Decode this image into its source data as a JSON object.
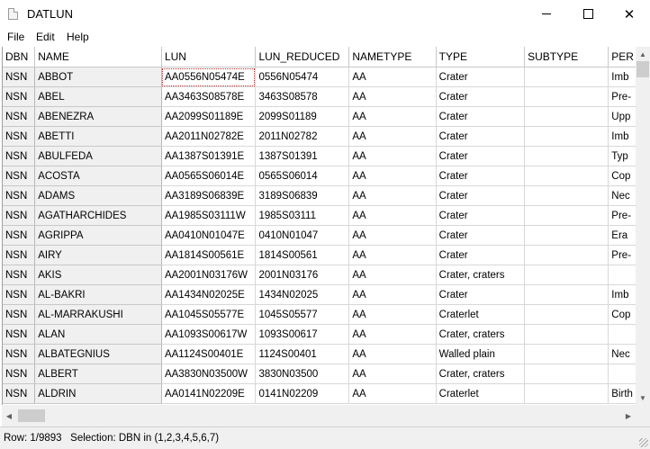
{
  "window": {
    "title": "DATLUN",
    "min_icon": "minimize-icon",
    "max_icon": "maximize-icon",
    "close_icon": "close-icon"
  },
  "menu": [
    "File",
    "Edit",
    "Help"
  ],
  "columns": [
    {
      "label": "DBN",
      "w": 31
    },
    {
      "label": "NAME",
      "w": 150
    },
    {
      "label": "LUN",
      "w": 100
    },
    {
      "label": "LUN_REDUCED",
      "w": 100
    },
    {
      "label": "NAMETYPE",
      "w": 100
    },
    {
      "label": "TYPE",
      "w": 100
    },
    {
      "label": "SUBTYPE",
      "w": 100
    },
    {
      "label": "PER",
      "w": 23
    }
  ],
  "rows": [
    [
      "NSN",
      "ABBOT",
      "AA0556N05474E",
      "0556N05474",
      "AA",
      "Crater",
      "",
      "Imb"
    ],
    [
      "NSN",
      "ABEL",
      "AA3463S08578E",
      "3463S08578",
      "AA",
      "Crater",
      "",
      "Pre-"
    ],
    [
      "NSN",
      "ABENEZRA",
      "AA2099S01189E",
      "2099S01189",
      "AA",
      "Crater",
      "",
      "Upp"
    ],
    [
      "NSN",
      "ABETTI",
      "AA2011N02782E",
      "2011N02782",
      "AA",
      "Crater",
      "",
      "Imb"
    ],
    [
      "NSN",
      "ABULFEDA",
      "AA1387S01391E",
      "1387S01391",
      "AA",
      "Crater",
      "",
      "Typ"
    ],
    [
      "NSN",
      "ACOSTA",
      "AA0565S06014E",
      "0565S06014",
      "AA",
      "Crater",
      "",
      "Cop"
    ],
    [
      "NSN",
      "ADAMS",
      "AA3189S06839E",
      "3189S06839",
      "AA",
      "Crater",
      "",
      "Nec"
    ],
    [
      "NSN",
      "AGATHARCHIDES",
      "AA1985S03111W",
      "1985S03111",
      "AA",
      "Crater",
      "",
      "Pre-"
    ],
    [
      "NSN",
      "AGRIPPA",
      "AA0410N01047E",
      "0410N01047",
      "AA",
      "Crater",
      "",
      "Era"
    ],
    [
      "NSN",
      "AIRY",
      "AA1814S00561E",
      "1814S00561",
      "AA",
      "Crater",
      "",
      "Pre-"
    ],
    [
      "NSN",
      "AKIS",
      "AA2001N03176W",
      "2001N03176",
      "AA",
      "Crater, craters",
      "",
      ""
    ],
    [
      "NSN",
      "AL-BAKRI",
      "AA1434N02025E",
      "1434N02025",
      "AA",
      "Crater",
      "",
      "Imb"
    ],
    [
      "NSN",
      "AL-MARRAKUSHI",
      "AA1045S05577E",
      "1045S05577",
      "AA",
      "Craterlet",
      "",
      "Cop"
    ],
    [
      "NSN",
      "ALAN",
      "AA1093S00617W",
      "1093S00617",
      "AA",
      "Crater, craters",
      "",
      ""
    ],
    [
      "NSN",
      "ALBATEGNIUS",
      "AA1124S00401E",
      "1124S00401",
      "AA",
      "Walled plain",
      "",
      "Nec"
    ],
    [
      "NSN",
      "ALBERT",
      "AA3830N03500W",
      "3830N03500",
      "AA",
      "Crater, craters",
      "",
      ""
    ],
    [
      "NSN",
      "ALDRIN",
      "AA0141N02209E",
      "0141N02209",
      "AA",
      "Craterlet",
      "",
      "Birth"
    ]
  ],
  "status": "Row: 1/9893   Selection: DBN in (1,2,3,4,5,6,7)"
}
